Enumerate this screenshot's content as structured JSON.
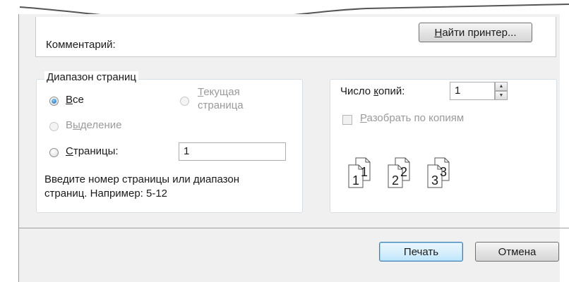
{
  "comment": {
    "label": "Комментарий:"
  },
  "find_printer": {
    "prefix": "",
    "accel": "Н",
    "rest": "айти принтер..."
  },
  "page_range": {
    "legend": "Диапазон страниц",
    "all": {
      "accel": "В",
      "rest": "се",
      "checked": true
    },
    "current": {
      "accel": "Т",
      "rest_line1": "екущая",
      "line2": "страница",
      "disabled": true
    },
    "selection": {
      "pre": "В",
      "accel": "ы",
      "rest": "деление",
      "disabled": true
    },
    "pages": {
      "accel": "С",
      "rest": "траницы:",
      "value": "1"
    },
    "hint_line1": "Введите номер страницы или диапазон",
    "hint_line2": "страниц.  Например: 5-12"
  },
  "copies": {
    "label_pre": "Число ",
    "label_accel": "к",
    "label_rest": "опий:",
    "value": "1",
    "collate_accel": "Р",
    "collate_rest": "азобрать по копиям",
    "collate_checked": false,
    "collate_disabled": true,
    "page_numbers": [
      "1",
      "1",
      "2",
      "2",
      "3",
      "3"
    ]
  },
  "buttons": {
    "print": "Печать",
    "cancel": "Отмена"
  }
}
